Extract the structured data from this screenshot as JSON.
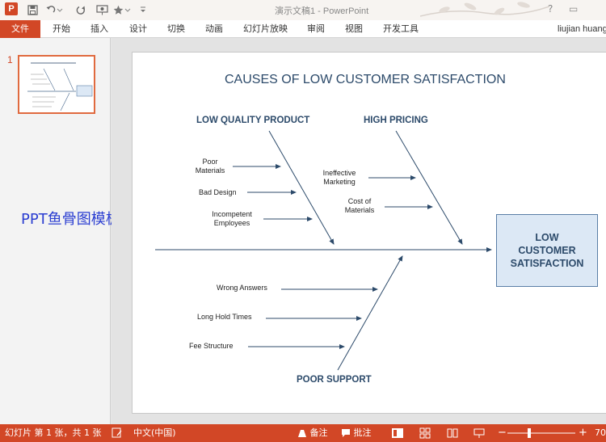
{
  "window": {
    "app_logo": "P",
    "doc_title": "演示文稿1 - PowerPoint",
    "help": "?",
    "restore": "▭"
  },
  "ribbon": {
    "tabs": [
      "文件",
      "开始",
      "插入",
      "设计",
      "切换",
      "动画",
      "幻灯片放映",
      "审阅",
      "视图",
      "开发工具"
    ],
    "user": "liujian huang"
  },
  "thumbnails": {
    "slide_number": "1"
  },
  "watermark": "PPT鱼骨图模板",
  "slide": {
    "title": "CAUSES OF LOW CUSTOMER SATISFACTION",
    "categories": {
      "quality": "LOW QUALITY PRODUCT",
      "pricing": "HIGH PRICING",
      "support": "POOR SUPPORT"
    },
    "causes": {
      "poor_materials_1": "Poor",
      "poor_materials_2": "Materials",
      "bad_design": "Bad Design",
      "incompetent_1": "Incompetent",
      "incompetent_2": "Employees",
      "ineffective_1": "Ineffective",
      "ineffective_2": "Marketing",
      "cost_1": "Cost of",
      "cost_2": "Materials",
      "wrong_answers": "Wrong Answers",
      "long_hold": "Long Hold Times",
      "fee_structure": "Fee Structure"
    },
    "effect": {
      "line1": "LOW",
      "line2": "CUSTOMER",
      "line3": "SATISFACTION"
    }
  },
  "status": {
    "slide_info": "幻灯片 第 1 张，共 1 张",
    "language": "中文(中国)",
    "notes": "备注",
    "comments": "批注",
    "zoom_minus": "−",
    "zoom_plus": "+",
    "zoom": "70"
  },
  "colors": {
    "accent": "#d24726",
    "ink": "#2c4a6a",
    "effect_fill": "#dce8f5"
  }
}
